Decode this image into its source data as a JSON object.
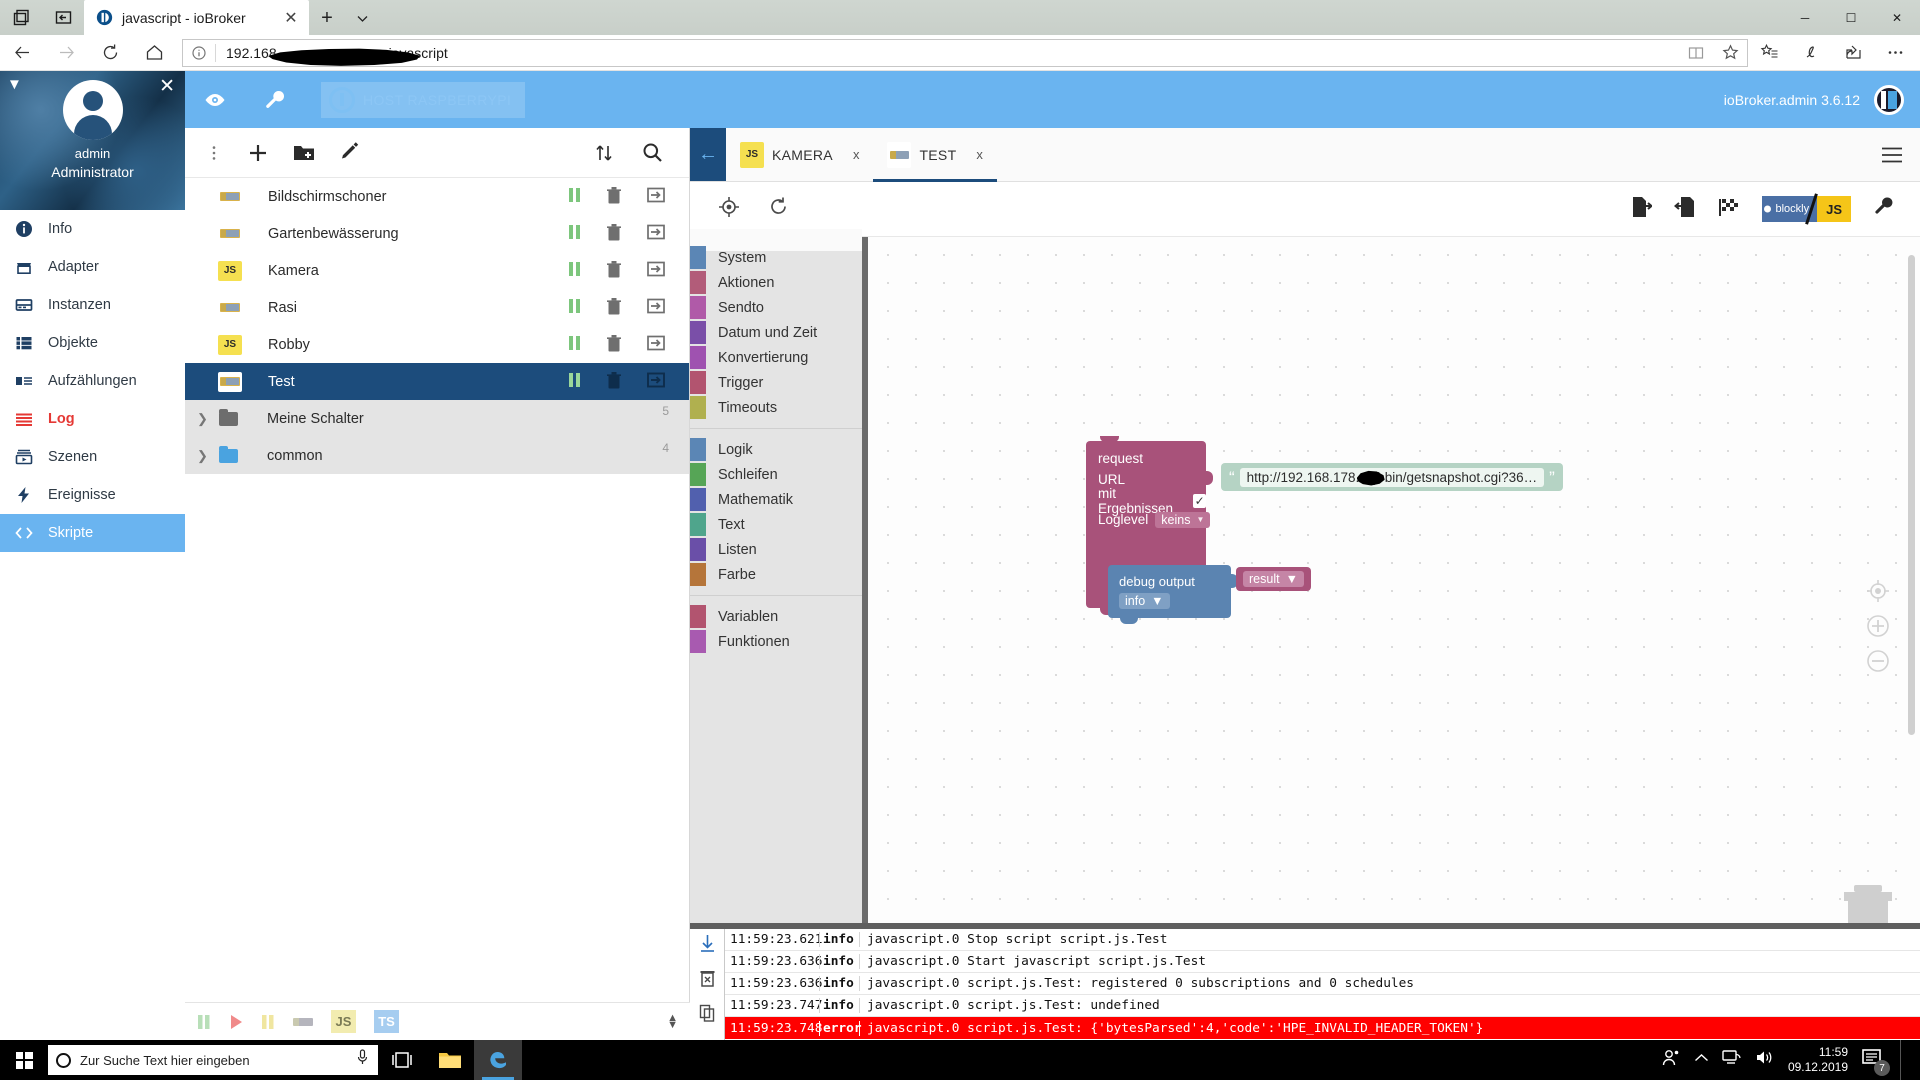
{
  "browser": {
    "tab_title": "javascript - ioBroker",
    "tab_close_label": "✕",
    "new_tab_label": "+",
    "tab_menu_icon": "chevron-down-icon",
    "address_value": "192.168",
    "address_suffix": "javascript",
    "window_minimize": "─",
    "window_maximize": "☐",
    "window_close": "✕"
  },
  "app_header": {
    "eye_icon": "eye-icon",
    "wrench_icon": "wrench-icon",
    "host_label": "HOST RASPBERRYPI",
    "version": "ioBroker.admin 3.6.12"
  },
  "sidebar": {
    "username": "admin",
    "role": "Administrator",
    "collapse_icon": "collapse-icon",
    "close_icon": "close-icon",
    "items": [
      {
        "label": "Info",
        "icon": "info-icon",
        "state": "normal"
      },
      {
        "label": "Adapter",
        "icon": "store-icon",
        "state": "normal"
      },
      {
        "label": "Instanzen",
        "icon": "instances-icon",
        "state": "normal"
      },
      {
        "label": "Objekte",
        "icon": "objects-list-icon",
        "state": "normal"
      },
      {
        "label": "Aufzählungen",
        "icon": "enums-icon",
        "state": "normal"
      },
      {
        "label": "Log",
        "icon": "log-lines-icon",
        "state": "alert"
      },
      {
        "label": "Szenen",
        "icon": "scenes-icon",
        "state": "normal"
      },
      {
        "label": "Ereignisse",
        "icon": "events-bolt-icon",
        "state": "normal"
      },
      {
        "label": "Skripte",
        "icon": "code-brackets-icon",
        "state": "active"
      }
    ]
  },
  "scripts_panel": {
    "toolbar": {
      "menu_icon": "vertical-dots-icon",
      "add_icon": "plus-icon",
      "add_folder_icon": "new-folder-icon",
      "edit_icon": "pencil-icon",
      "expand_icon": "expand-collapse-icon",
      "search_icon": "search-icon"
    },
    "rows": [
      {
        "name": "Bildschirmschoner",
        "type": "blockly",
        "selected": false
      },
      {
        "name": "Gartenbewässerung",
        "type": "blockly",
        "selected": false
      },
      {
        "name": "Kamera",
        "type": "js",
        "selected": false
      },
      {
        "name": "Rasi",
        "type": "blockly",
        "selected": false
      },
      {
        "name": "Robby",
        "type": "js",
        "selected": false
      },
      {
        "name": "Test",
        "type": "blockly",
        "selected": true
      }
    ],
    "folders": [
      {
        "name": "Meine Schalter",
        "count": "5",
        "color": "#6d6d6d"
      },
      {
        "name": "common",
        "count": "4",
        "color": "#4aa3e0"
      }
    ],
    "bottom_bar": {
      "pause_icon": "pause-icon",
      "play_icon": "play-icon",
      "pause2_icon": "pause-icon",
      "blockly_icon": "blockly-icon",
      "js_label": "JS",
      "ts_label": "TS",
      "resize_icon": "resize-handle-icon"
    }
  },
  "editor": {
    "back_icon": "back-arrow-icon",
    "burger_icon": "hamburger-menu-icon",
    "tabs": [
      {
        "label": "KAMERA",
        "type": "js",
        "active": false,
        "close": "x"
      },
      {
        "label": "TEST",
        "type": "blockly",
        "active": true,
        "close": "x"
      }
    ],
    "toolbar": {
      "locate_icon": "crosshair-target-icon",
      "reload_icon": "reload-icon",
      "export_icon": "export-file-icon",
      "import_icon": "import-file-icon",
      "checkered_icon": "checkered-flag-icon",
      "blockly_label": "blockly",
      "js_label": "JS",
      "settings_icon": "wrench-icon"
    }
  },
  "toolbox": {
    "groups": [
      {
        "categories": [
          {
            "label": "System",
            "color": "#5b86b5"
          },
          {
            "label": "Aktionen",
            "color": "#b25c79"
          },
          {
            "label": "Sendto",
            "color": "#b05aa8"
          },
          {
            "label": "Datum und Zeit",
            "color": "#7a4fa8"
          },
          {
            "label": "Konvertierung",
            "color": "#9f52b0"
          },
          {
            "label": "Trigger",
            "color": "#b2546f"
          },
          {
            "label": "Timeouts",
            "color": "#b0b04f"
          }
        ]
      },
      {
        "categories": [
          {
            "label": "Logik",
            "color": "#5b86b5"
          },
          {
            "label": "Schleifen",
            "color": "#56a556"
          },
          {
            "label": "Mathematik",
            "color": "#5160ae"
          },
          {
            "label": "Text",
            "color": "#4fa58c"
          },
          {
            "label": "Listen",
            "color": "#6a4fa8"
          },
          {
            "label": "Farbe",
            "color": "#b5753a"
          }
        ]
      },
      {
        "categories": [
          {
            "label": "Variablen",
            "color": "#b2546f"
          },
          {
            "label": "Funktionen",
            "color": "#a85ab0"
          }
        ]
      }
    ]
  },
  "blocks": {
    "request": {
      "title": "request",
      "url_label": "URL",
      "with_results_label": "mit Ergebnissen",
      "with_results_checked": "✓",
      "loglevel_label": "Loglevel",
      "loglevel_value": "keins",
      "color": "#a8527a"
    },
    "url_string": {
      "open_quote": "“",
      "close_quote": "”",
      "value": "http://192.168.178.     cgi-bin/getsnapshot.cgi?36…",
      "color": "#b5d3c4"
    },
    "debug": {
      "label": "debug output",
      "level": "info",
      "color": "#5b84b1"
    },
    "result": {
      "label": "result",
      "color": "#a8527a"
    }
  },
  "log": {
    "side_icons": {
      "download_icon": "download-icon",
      "clear_icon": "clear-log-icon",
      "copy_icon": "copy-icon",
      "layout_icon": "layout-toggle-icon"
    },
    "rows": [
      {
        "time": "11:59:23.621",
        "level": "info",
        "message": "javascript.0 Stop script script.js.Test",
        "severity": "info"
      },
      {
        "time": "11:59:23.636",
        "level": "info",
        "message": "javascript.0 Start javascript script.js.Test",
        "severity": "info"
      },
      {
        "time": "11:59:23.636",
        "level": "info",
        "message": "javascript.0 script.js.Test: registered 0 subscriptions and 0 schedules",
        "severity": "info"
      },
      {
        "time": "11:59:23.747",
        "level": "info",
        "message": "javascript.0 script.js.Test: undefined",
        "severity": "info"
      },
      {
        "time": "11:59:23.748",
        "level": "error",
        "message": "javascript.0 script.js.Test: {'bytesParsed':4,'code':'HPE_INVALID_HEADER_TOKEN'}",
        "severity": "error"
      }
    ]
  },
  "taskbar": {
    "start_icon": "windows-start-icon",
    "search_placeholder": "Zur Suche Text hier eingeben",
    "mic_icon": "microphone-icon",
    "taskview_icon": "task-view-icon",
    "explorer_icon": "file-explorer-icon",
    "edge_icon": "edge-browser-icon",
    "tray": {
      "people_icon": "people-icon",
      "chevron_icon": "chevron-up-icon",
      "network_icon": "network-icon",
      "volume_icon": "volume-icon",
      "time": "11:59",
      "date": "09.12.2019",
      "notification_count": "7"
    }
  }
}
